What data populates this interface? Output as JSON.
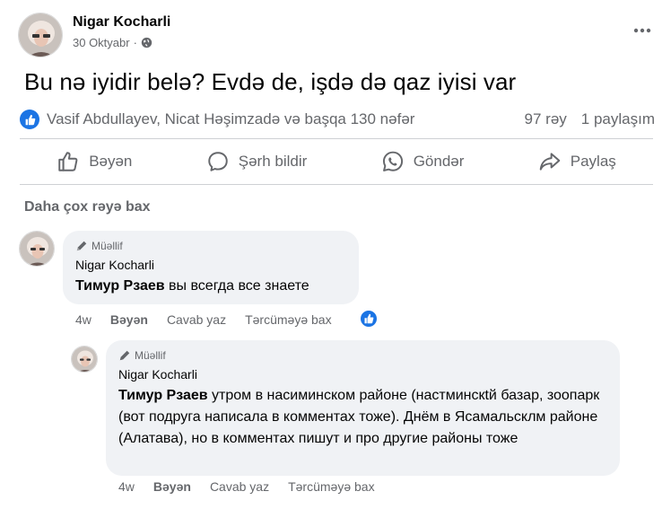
{
  "post": {
    "author": "Nigar Kocharli",
    "date": "30 Oktyabr",
    "date_separator": "·",
    "text": "Bu nə iyidir belə? Evdə de, işdə də qaz iyisi var"
  },
  "reactions": {
    "reactors": "Vasif Abdullayev, Nicat Həşimzadə və başqa 130 nəfər",
    "comments_count": "97 rəy",
    "shares_count": "1 paylaşım"
  },
  "actions": {
    "like": "Bəyən",
    "comment": "Şərh bildir",
    "send": "Göndər",
    "share": "Paylaş"
  },
  "more_comments": "Daha çox rəyə bax",
  "comments": [
    {
      "badge": "Müəllif",
      "author": "Nigar Kocharli",
      "mention": "Тимур Рзаев",
      "text": " вы всегда все знаете",
      "time": "4w",
      "like": "Bəyən",
      "reply": "Cavab yaz",
      "translate": "Tərcüməyə bax"
    },
    {
      "badge": "Müəllif",
      "author": "Nigar Kocharli",
      "mention": "Тимур Рзаев",
      "text": " утром в насиминском районе (настминскtй базар, зоопарк (вот подруга написала в комментах тоже). Днём в Ясамальсклм районе (Алатава), но в комментах пишут и про другие районы тоже",
      "time": "4w",
      "like": "Bəyən",
      "reply": "Cavab yaz",
      "translate": "Tərcüməyə bax"
    }
  ],
  "colors": {
    "accent": "#1b74e4",
    "secondary_text": "#65676b",
    "bubble": "#f0f2f5",
    "divider": "#ced0d4"
  }
}
